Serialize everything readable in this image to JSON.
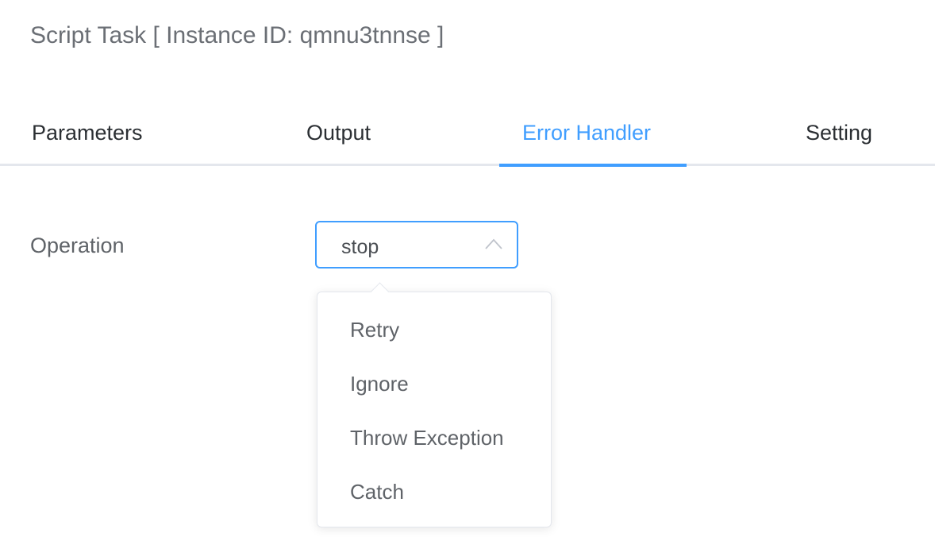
{
  "header": {
    "title": "Script Task [ Instance ID: qmnu3tnnse ]"
  },
  "tabs": [
    {
      "label": "Parameters",
      "active": false
    },
    {
      "label": "Output",
      "active": false
    },
    {
      "label": "Error Handler",
      "active": true
    },
    {
      "label": "Setting",
      "active": false
    }
  ],
  "form": {
    "operation_label": "Operation",
    "operation_value": "stop",
    "options": [
      "Retry",
      "Ignore",
      "Throw Exception",
      "Catch"
    ]
  },
  "colors": {
    "accent": "#409eff",
    "text": "#2b2f33",
    "muted": "#5f6368",
    "border": "#e4e7ed"
  },
  "icons": {
    "select_arrow": "chevron-up-icon"
  }
}
